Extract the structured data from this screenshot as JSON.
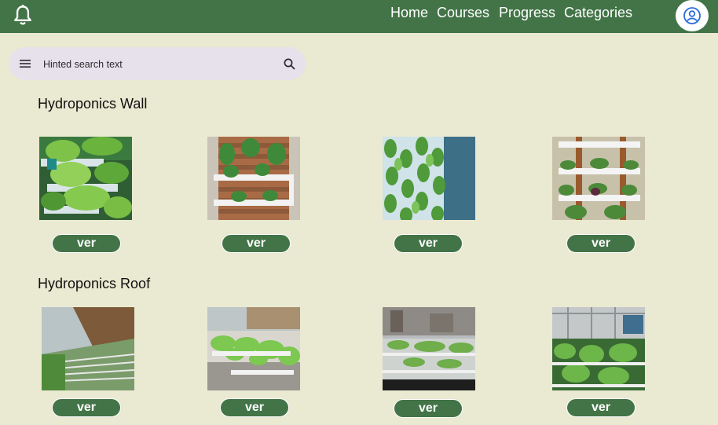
{
  "header": {
    "nav": [
      {
        "label": "Home"
      },
      {
        "label": "Courses"
      },
      {
        "label": "Progress"
      },
      {
        "label": "Categories"
      }
    ]
  },
  "search": {
    "placeholder": "Hinted search text"
  },
  "sections": [
    {
      "title": "Hydroponics Wall",
      "items": [
        {
          "button": "ver"
        },
        {
          "button": "ver"
        },
        {
          "button": "ver"
        },
        {
          "button": "ver"
        }
      ]
    },
    {
      "title": "Hydroponics Roof",
      "items": [
        {
          "button": "ver"
        },
        {
          "button": "ver"
        },
        {
          "button": "ver"
        },
        {
          "button": "ver"
        }
      ]
    }
  ],
  "colors": {
    "primary": "#427447",
    "background": "#eae9d1",
    "search_bg": "#e7e1ec",
    "avatar_accent": "#2b6fd6"
  },
  "icons": {
    "notifications": "bell-icon",
    "menu": "menu-icon",
    "search": "search-icon",
    "account": "account-circle-icon"
  }
}
